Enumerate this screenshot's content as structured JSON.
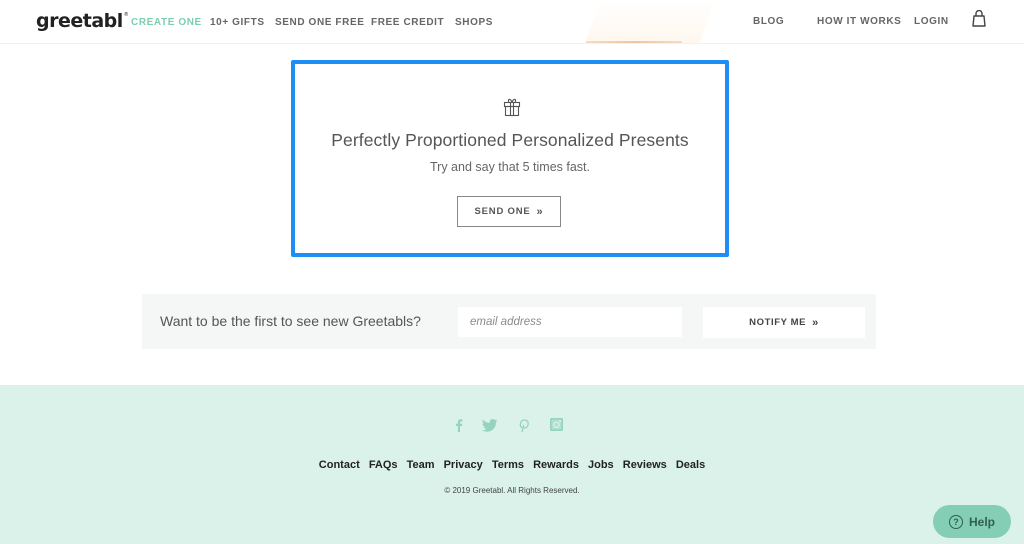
{
  "header": {
    "logo": "greetabl",
    "logo_mark": "®",
    "nav_left": [
      {
        "label": "CREATE ONE",
        "active": true
      },
      {
        "label": "10+ GIFTS",
        "active": false
      },
      {
        "label": "SEND ONE FREE",
        "active": false
      },
      {
        "label": "FREE CREDIT",
        "active": false
      },
      {
        "label": "SHOPS",
        "active": false
      }
    ],
    "nav_right": [
      {
        "label": "BLOG"
      },
      {
        "label": "HOW IT WORKS"
      },
      {
        "label": "LOGIN"
      }
    ],
    "cart_icon": "shopping-bag-icon"
  },
  "card": {
    "icon": "gift-icon",
    "title": "Perfectly Proportioned Personalized Presents",
    "subtitle": "Try and say that 5 times fast.",
    "button_label": "SEND ONE",
    "button_chevron": "»",
    "highlight_color": "#1e8ef5"
  },
  "notify": {
    "label": "Want to be the first to see new Greetabls?",
    "email_placeholder": "email address",
    "email_value": "",
    "button_label": "NOTIFY ME",
    "button_chevron": "»"
  },
  "footer": {
    "social_icons": [
      "facebook-icon",
      "twitter-icon",
      "pinterest-icon",
      "instagram-icon"
    ],
    "links": [
      "Contact",
      "FAQs",
      "Team",
      "Privacy",
      "Terms",
      "Rewards",
      "Jobs",
      "Reviews",
      "Deals"
    ],
    "copyright": "© 2019 Greetabl. All Rights Reserved.",
    "background_color": "#dbf2eb"
  },
  "help": {
    "label": "Help",
    "icon_glyph": "?"
  },
  "colors": {
    "accent": "#7ccfae",
    "help_bg": "#84ceb5"
  }
}
